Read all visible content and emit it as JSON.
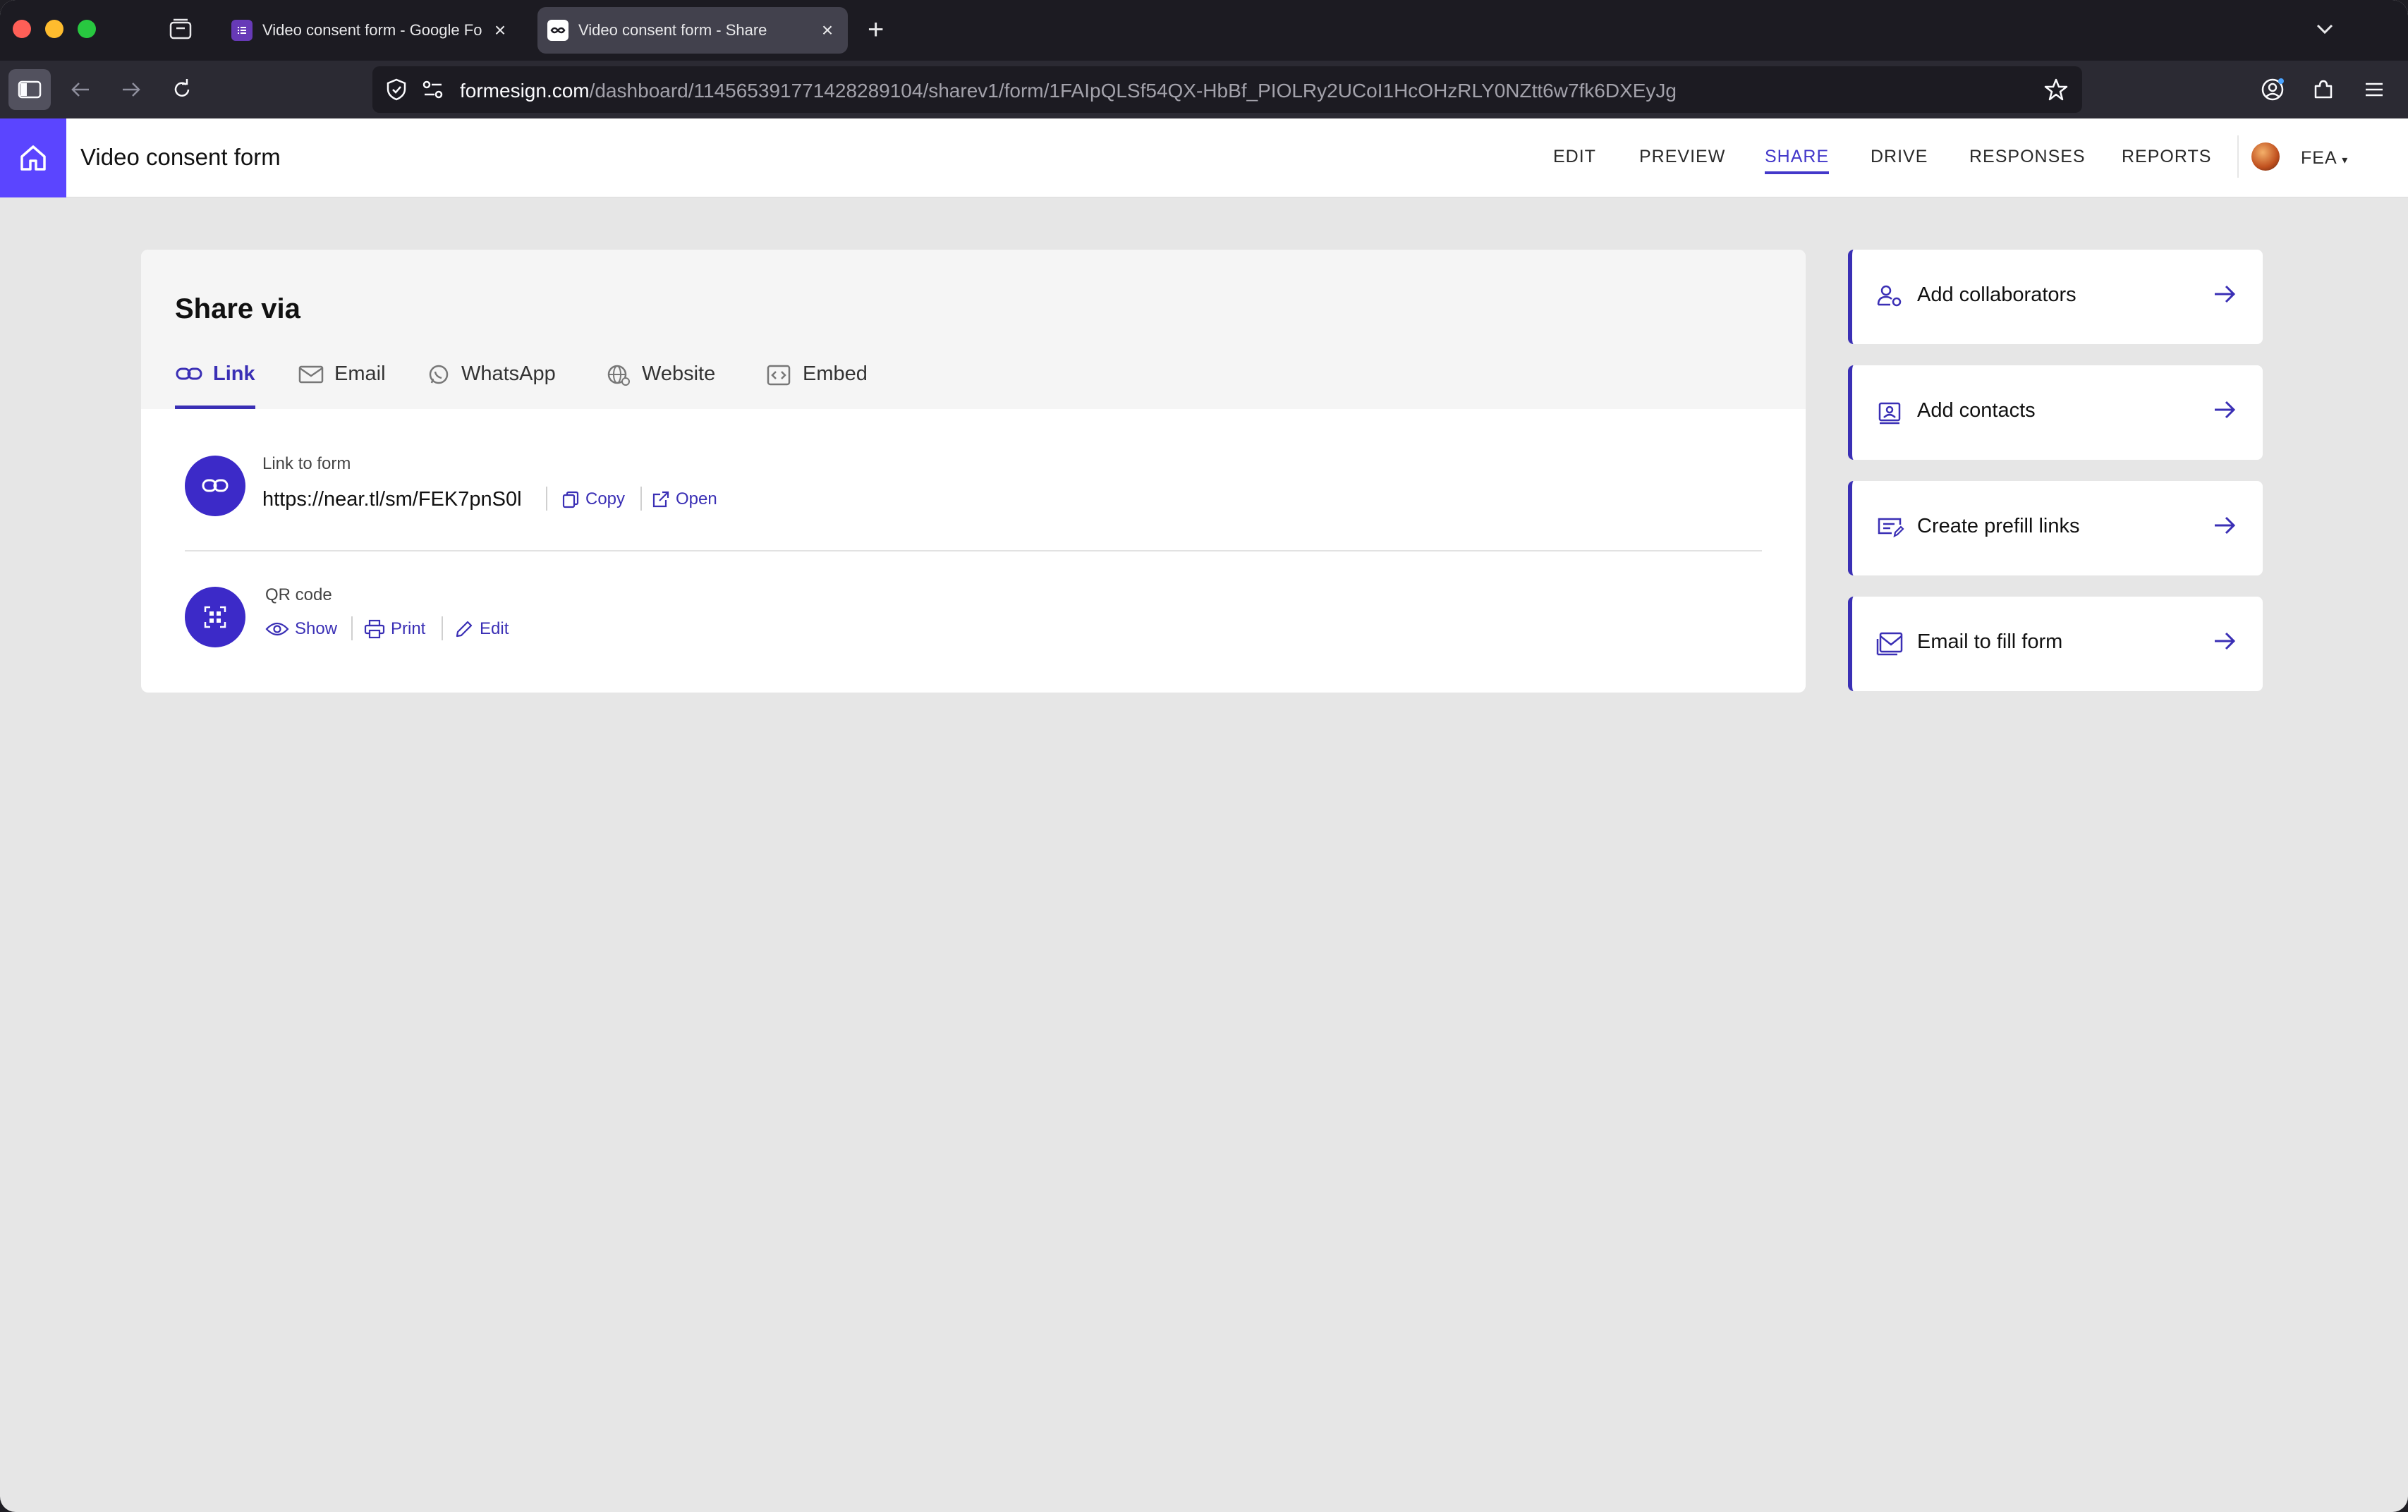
{
  "browser": {
    "tabs": [
      {
        "title": "Video consent form - Google Fo",
        "active": false
      },
      {
        "title": "Video consent form - Share",
        "active": true
      }
    ],
    "url_host": "formesign.com",
    "url_path": "/dashboard/114565391771428289104/sharev1/form/1FAIpQLSf54QX-HbBf_PIOLRy2UCoI1HcOHzRLY0NZtt6w7fk6DXEyJg"
  },
  "app": {
    "title": "Video consent form",
    "nav": [
      "EDIT",
      "PREVIEW",
      "SHARE",
      "DRIVE",
      "RESPONSES",
      "REPORTS"
    ],
    "active_nav": "SHARE",
    "user_label": "FEA",
    "accent_color": "#3a2fb5",
    "brand_color": "#5b45ff"
  },
  "share": {
    "title": "Share via",
    "tabs": [
      "Link",
      "Email",
      "WhatsApp",
      "Website",
      "Embed"
    ],
    "active_tab": "Link",
    "link_label": "Link to form",
    "link_url": "https://near.tl/sm/FEK7pnS0l",
    "copy_label": "Copy",
    "open_label": "Open",
    "qr_label": "QR code",
    "show_label": "Show",
    "print_label": "Print",
    "edit_label": "Edit"
  },
  "side_actions": [
    {
      "label": "Add collaborators",
      "icon": "collaborators-icon"
    },
    {
      "label": "Add contacts",
      "icon": "contacts-icon"
    },
    {
      "label": "Create prefill links",
      "icon": "prefill-icon"
    },
    {
      "label": "Email to fill form",
      "icon": "email-icon"
    }
  ]
}
